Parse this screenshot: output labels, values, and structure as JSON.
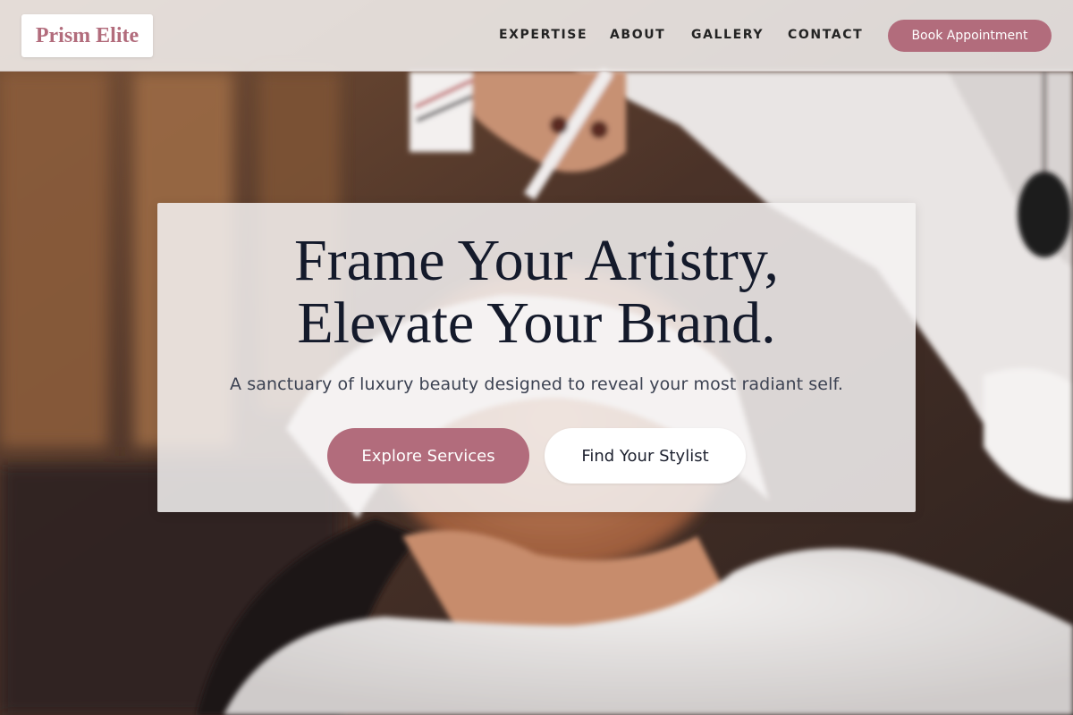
{
  "brand": {
    "name": "Prism Elite",
    "accent_color": "#b26c7c"
  },
  "nav": {
    "items": [
      {
        "label": "EXPERTISE"
      },
      {
        "label": "ABOUT"
      },
      {
        "label": "GALLERY"
      },
      {
        "label": "CONTACT"
      }
    ],
    "cta_label": "Book Appointment"
  },
  "hero": {
    "title_line1": "Frame Your Artistry,",
    "title_line2": "Elevate Your Brand.",
    "subtitle": "A sanctuary of luxury beauty designed to reveal your most radiant self.",
    "primary_button": "Explore Services",
    "secondary_button": "Find Your Stylist",
    "background_image": "facial-treatment-photo"
  }
}
